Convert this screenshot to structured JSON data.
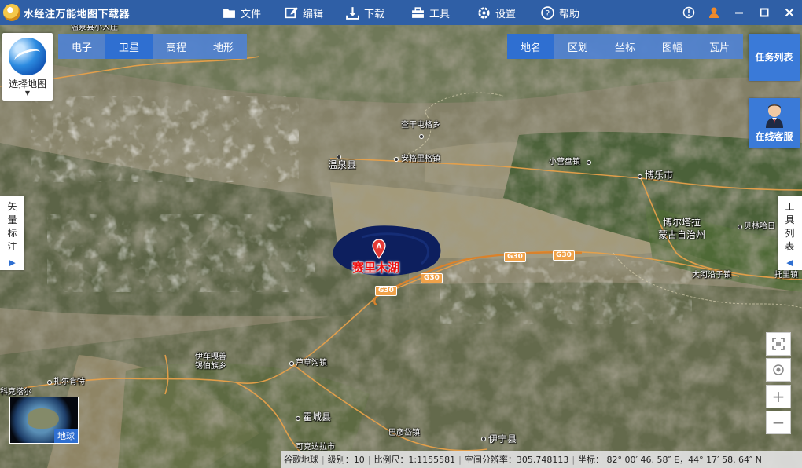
{
  "app": {
    "title": "水经注万能地图下载器"
  },
  "menu": [
    {
      "label": "文件",
      "icon": "folder-icon"
    },
    {
      "label": "编辑",
      "icon": "edit-icon"
    },
    {
      "label": "下载",
      "icon": "download-icon"
    },
    {
      "label": "工具",
      "icon": "toolbox-icon"
    },
    {
      "label": "设置",
      "icon": "gear-icon"
    },
    {
      "label": "帮助",
      "icon": "help-icon"
    }
  ],
  "select_map": {
    "label": "选择地图"
  },
  "map_type_tabs": [
    {
      "label": "电子",
      "active": false
    },
    {
      "label": "卫星",
      "active": true
    },
    {
      "label": "高程",
      "active": false
    },
    {
      "label": "地形",
      "active": false
    }
  ],
  "overlay_tabs": [
    {
      "label": "地名",
      "active": true
    },
    {
      "label": "区划",
      "active": false
    },
    {
      "label": "坐标",
      "active": false
    },
    {
      "label": "图幅",
      "active": false
    },
    {
      "label": "瓦片",
      "active": false
    }
  ],
  "task_list": {
    "label": "任务列表"
  },
  "online_service": {
    "label": "在线客服"
  },
  "vector_panel": {
    "label": "矢量标注"
  },
  "tool_panel": {
    "label": "工具列表"
  },
  "earth_thumb": {
    "label": "地球"
  },
  "map_labels": {
    "chagan": "查干屯格乡",
    "wenquan": "温泉县",
    "angeli": "安格里格镇",
    "xiaoyingpan": "小营盘镇",
    "bole": "博乐市",
    "bortala_1": "博尔塔拉",
    "bortala_2": "蒙古自治州",
    "beilinhadi": "贝林哈日",
    "dahe": "大河沿子镇",
    "tuoli": "托里镇",
    "yichehaoshan_1": "伊车嘎善",
    "yichehaoshan_2": "锡伯族乡",
    "lucaogou": "芦草沟镇",
    "zhaerkente": "扎尔肯特",
    "huocheng": "霍城县",
    "kaketala": "可克达拉市",
    "bayandai": "巴彦岱镇",
    "yining": "伊宁县",
    "kektal": "科克塔尔",
    "top_left": "温泉县小人庄",
    "lake": "赛里木湖",
    "marker": "A"
  },
  "roads": {
    "g30": "G30"
  },
  "status": {
    "source": "谷歌地球",
    "level": "级别：10",
    "scale": "比例尺：1:1155581",
    "resolution": "空间分辨率：305.748113",
    "coordinate": "坐标：  82° 00′ 46. 58″ E，44° 17′ 58. 64″ N"
  }
}
